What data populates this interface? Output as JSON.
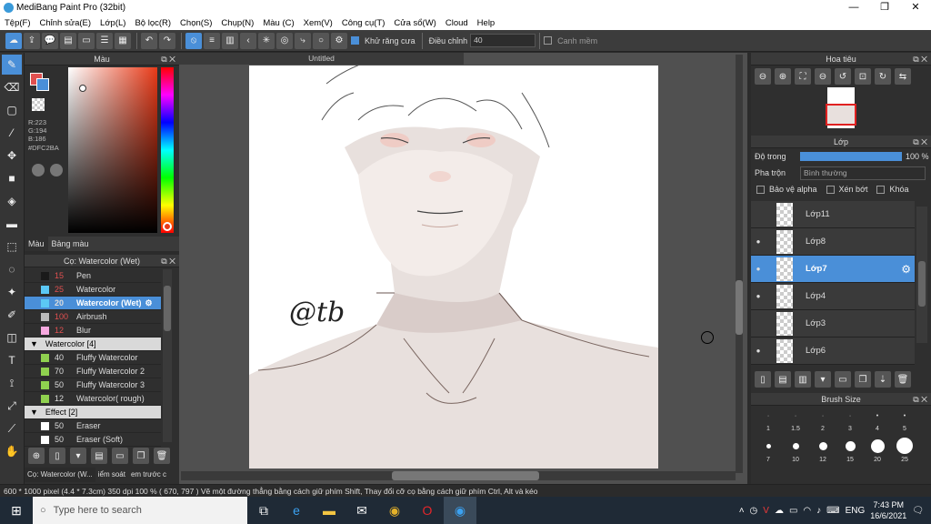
{
  "window": {
    "title": "MediBang Paint Pro (32bit)"
  },
  "menu": [
    "Tệp(F)",
    "Chỉnh sửa(E)",
    "Lớp(L)",
    "Bộ lọc(R)",
    "Chọn(S)",
    "Chụp(N)",
    "Màu (C)",
    "Xem(V)",
    "Công cụ(T)",
    "Cửa sổ(W)",
    "Cloud",
    "Help"
  ],
  "toolbar": {
    "antialias_label": "Khử răng cưa",
    "adjust_label": "Điều chỉnh",
    "adjust_value": "40",
    "edge_label": "Canh mềm"
  },
  "color_panel": {
    "title": "Màu",
    "r": "R:223",
    "g": "G:194",
    "b": "B:186",
    "hex": "#DFC2BA",
    "tab_color": "Màu",
    "tab_palette": "Bảng màu"
  },
  "brush_panel": {
    "title": "Cọ: Watercolor (Wet)",
    "rows": [
      {
        "num": "15",
        "name": "Pen",
        "color": "#1a1a1a",
        "type": "item"
      },
      {
        "num": "25",
        "name": "Watercolor",
        "color": "#5bc8f5",
        "type": "item"
      },
      {
        "num": "20",
        "name": "Watercolor (Wet)",
        "color": "#5bc8f5",
        "type": "sel"
      },
      {
        "num": "100",
        "name": "Airbrush",
        "color": "#bbbbbb",
        "type": "item"
      },
      {
        "num": "12",
        "name": "Blur",
        "color": "#f7a9e0",
        "type": "item"
      },
      {
        "num": "",
        "name": "Watercolor [4]",
        "color": "",
        "type": "grp"
      },
      {
        "num": "40",
        "name": "Fluffy Watercolor",
        "color": "#8fd14f",
        "type": "item"
      },
      {
        "num": "70",
        "name": "Fluffy Watercolor 2",
        "color": "#8fd14f",
        "type": "item"
      },
      {
        "num": "50",
        "name": "Fluffy Watercolor 3",
        "color": "#8fd14f",
        "type": "item"
      },
      {
        "num": "12",
        "name": "Watercolor( rough)",
        "color": "#8fd14f",
        "type": "item"
      },
      {
        "num": "",
        "name": "Effect [2]",
        "color": "",
        "type": "grp"
      },
      {
        "num": "50",
        "name": "Eraser",
        "color": "#ffffff",
        "type": "item"
      },
      {
        "num": "50",
        "name": "Eraser (Soft)",
        "color": "#ffffff",
        "type": "item"
      }
    ]
  },
  "bottom_tabs": [
    "Cọ: Watercolor (W...",
    "iểm soát",
    "em trước c"
  ],
  "canvas": {
    "tab": "Untitled",
    "signature": "@tb"
  },
  "navigator": {
    "title": "Hoa tiêu"
  },
  "layer_panel": {
    "title": "Lớp",
    "opacity_label": "Độ trong",
    "opacity_value": "100 %",
    "blend_label": "Pha trộn",
    "blend_value": "Bình thường",
    "protect_alpha": "Bảo vệ alpha",
    "clip": "Xén bớt",
    "lock": "Khóa",
    "layers": [
      {
        "name": "Lớp11",
        "visible": false,
        "selected": false
      },
      {
        "name": "Lớp8",
        "visible": true,
        "selected": false
      },
      {
        "name": "Lớp7",
        "visible": true,
        "selected": true
      },
      {
        "name": "Lớp4",
        "visible": true,
        "selected": false
      },
      {
        "name": "Lớp3",
        "visible": false,
        "selected": false
      },
      {
        "name": "Lớp6",
        "visible": true,
        "selected": false
      }
    ]
  },
  "brush_size": {
    "title": "Brush Size",
    "row1": [
      "1",
      "1.5",
      "2",
      "3",
      "4",
      "5"
    ],
    "row2": [
      "7",
      "10",
      "12",
      "15",
      "20",
      "25"
    ]
  },
  "status": {
    "text": "600 * 1000 pixel   (4.4 * 7.3cm)   350 dpi   100 %   ( 670, 797 )   Vẽ một đường thẳng bằng cách giữ phím Shift, Thay đổi cỡ cọ bằng cách giữ phím Ctrl, Alt và kéo"
  },
  "taskbar": {
    "search": "Type here to search",
    "lang": "ENG",
    "time": "7:43 PM",
    "date": "16/6/2021"
  }
}
